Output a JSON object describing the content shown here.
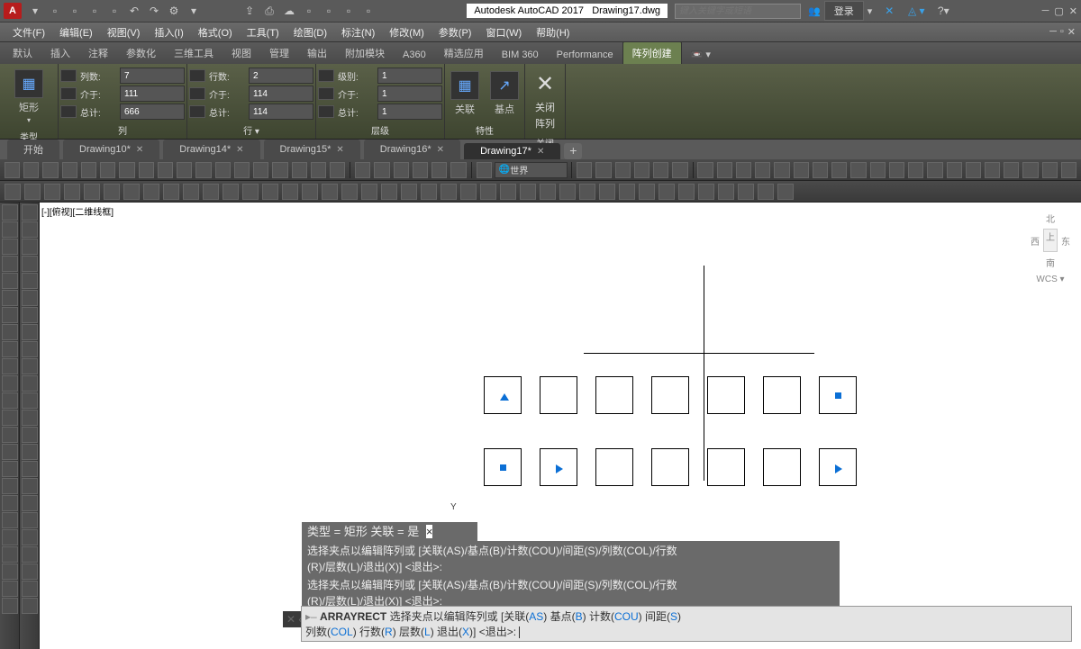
{
  "app": {
    "name": "Autodesk AutoCAD 2017",
    "file": "Drawing17.dwg"
  },
  "search_placeholder": "键入关键字或短语",
  "login_label": "登录",
  "menus": [
    "文件(F)",
    "编辑(E)",
    "视图(V)",
    "插入(I)",
    "格式(O)",
    "工具(T)",
    "绘图(D)",
    "标注(N)",
    "修改(M)",
    "参数(P)",
    "窗口(W)",
    "帮助(H)"
  ],
  "ribbon_tabs": [
    "默认",
    "插入",
    "注释",
    "参数化",
    "三维工具",
    "视图",
    "管理",
    "输出",
    "附加模块",
    "A360",
    "精选应用",
    "BIM 360",
    "Performance"
  ],
  "ribbon_active": "阵列创建",
  "panels": {
    "type": {
      "title": "类型",
      "btn": "矩形"
    },
    "cols": {
      "title": "列",
      "labels": [
        "列数:",
        "介于:",
        "总计:"
      ],
      "vals": [
        "7",
        "111",
        "666"
      ]
    },
    "rows": {
      "title": "行 ▾",
      "labels": [
        "行数:",
        "介于:",
        "总计:"
      ],
      "vals": [
        "2",
        "114",
        "114"
      ]
    },
    "levels": {
      "title": "层级",
      "labels": [
        "级别:",
        "介于:",
        "总计:"
      ],
      "vals": [
        "1",
        "1",
        "1"
      ]
    },
    "props": {
      "title": "特性",
      "assoc": "关联",
      "base": "基点"
    },
    "close": {
      "title": "关闭",
      "btn1": "关闭",
      "btn2": "阵列"
    }
  },
  "doc_tabs": [
    {
      "label": "开始",
      "star": false
    },
    {
      "label": "Drawing10*",
      "star": true
    },
    {
      "label": "Drawing14*",
      "star": true
    },
    {
      "label": "Drawing15*",
      "star": true
    },
    {
      "label": "Drawing16*",
      "star": true
    }
  ],
  "doc_active": "Drawing17*",
  "layer_name": "世界",
  "viewport_label": "[-][俯视][二维线框]",
  "vcube": {
    "n": "北",
    "w": "西",
    "top": "上",
    "e": "东",
    "s": "南",
    "wcs": "WCS ▾"
  },
  "y_axis": "Y",
  "cmd_type_line": "类型 = 矩形   关联 = 是",
  "cmd_prompt_fragments": {
    "prefix": "选择夹点以编辑阵列或 [关联(AS)/基点(B)/计数(COU)/间距(S)/列数(COL)/行数",
    "suffix": "(R)/层数(L)/退出(X)] <退出>:"
  },
  "cmd_input": {
    "cmd": "ARRAYRECT",
    "l1": "选择夹点以编辑阵列或 [关联(AS) 基点(B) 计数(COU) 间距(S)",
    "l2": "列数(COL) 行数(R) 层数(L) 退出(X)] <退出>:"
  }
}
